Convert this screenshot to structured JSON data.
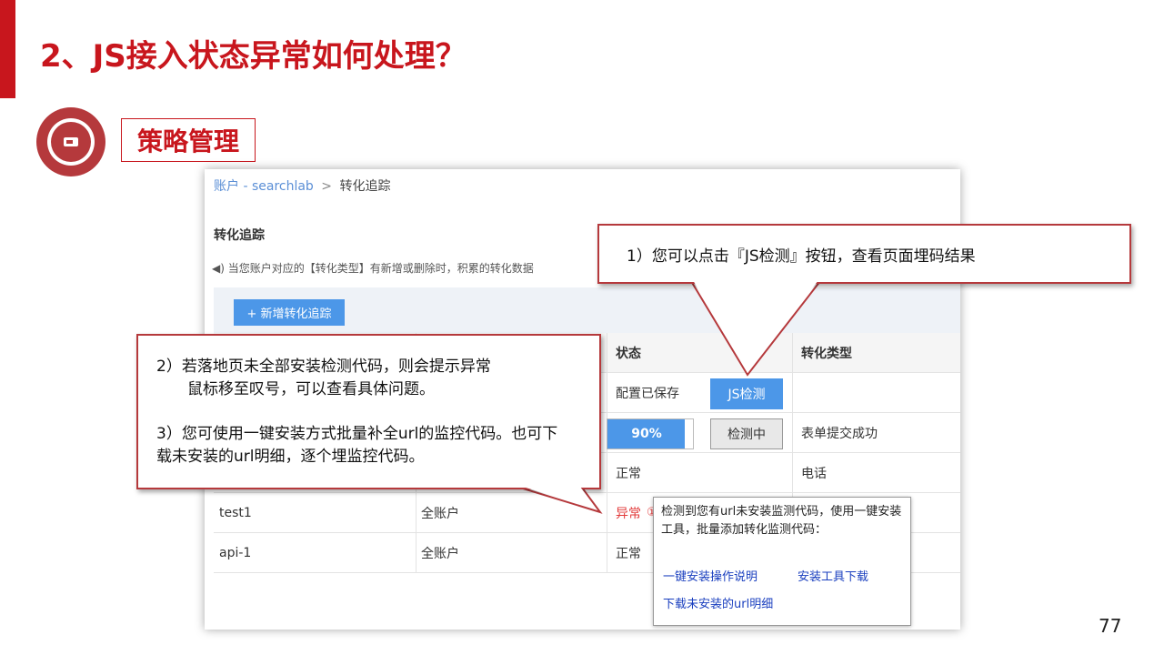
{
  "slide": {
    "title": "2、JS接入状态异常如何处理？",
    "section": "策略管理",
    "page_number": "77",
    "accent_color": "#c8161d",
    "section_icon": "ticket-icon"
  },
  "screenshot": {
    "breadcrumb": {
      "account": "账户 - searchlab",
      "separator": ">",
      "current": "转化追踪"
    },
    "heading": "转化追踪",
    "notice_icon": "speaker-icon",
    "notice": "当您账户对应的【转化类型】有新增或删除时，积累的转化数据",
    "add_button": "+ 新增转化追踪",
    "columns": {
      "status": "状态",
      "type": "转化类型"
    },
    "rows": [
      {
        "name": "",
        "scope": "",
        "status": "配置已保存",
        "type": ""
      },
      {
        "name": "",
        "scope": "",
        "status": "",
        "type": "表单提交成功"
      },
      {
        "name": "",
        "scope": "",
        "status": "正常",
        "type": "电话"
      },
      {
        "name": "test1",
        "scope": "全账户",
        "status": "异常",
        "status_icon": "info-circle-icon",
        "type": ""
      },
      {
        "name": "api-1",
        "scope": "全账户",
        "status": "正常",
        "type": ""
      }
    ],
    "js_button": "JS检测",
    "progress": {
      "label": "90%",
      "value": 0.9
    },
    "detecting_button": "检测中",
    "tooltip": {
      "text": "检测到您有url未安装监测代码，使用一键安装工具，批量添加转化监测代码：",
      "link_guide": "一键安装操作说明",
      "link_download_tool": "安装工具下载",
      "link_download_urls": "下载未安装的url明细"
    }
  },
  "callouts": {
    "c1": "1）您可以点击『JS检测』按钮，查看页面埋码结果",
    "c2_line1": "2）若落地页未全部安装检测代码，则会提示异常",
    "c2_line2": "鼠标移至叹号，可以查看具体问题。",
    "c3": "3）您可使用一键安装方式批量补全url的监控代码。也可下载未安装的url明细，逐个埋监控代码。"
  }
}
